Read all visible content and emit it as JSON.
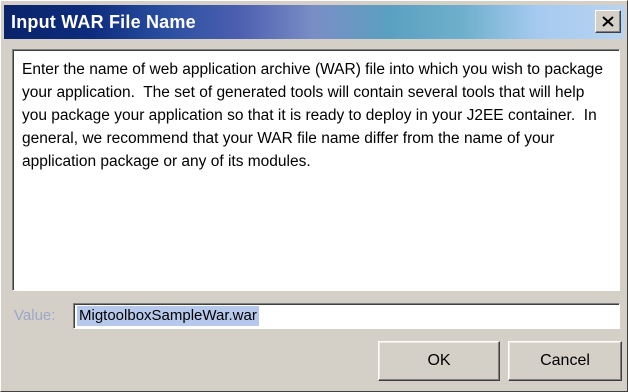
{
  "dialog": {
    "title": "Input WAR File Name",
    "close_icon": "close-icon",
    "message": "Enter the name of web application archive (WAR) file into which you wish to package your application.  The set of generated tools will contain several tools that will help you package your application so that it is ready to deploy in your J2EE container.  In general, we recommend that your WAR file name differ from the name of your application package or any of its modules.",
    "value_label": "Value:",
    "value_text": "MigtoolboxSampleWar.war",
    "ok_label": "OK",
    "cancel_label": "Cancel"
  }
}
